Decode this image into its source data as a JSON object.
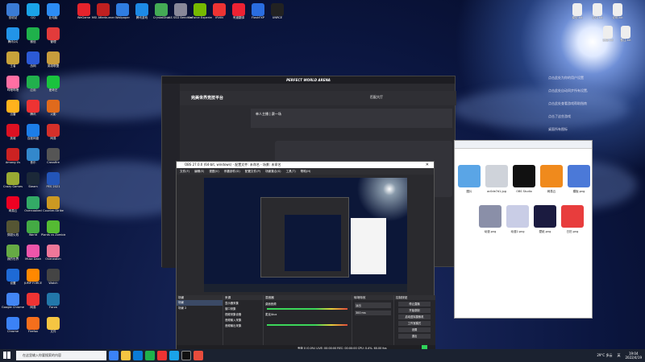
{
  "desktop": {
    "left_icons": [
      {
        "label": "回收站",
        "color": "#3a7bd5"
      },
      {
        "label": "QQ",
        "color": "#1aa3e8"
      },
      {
        "label": "此电脑",
        "color": "#2c8cf4"
      },
      {
        "label": "腾讯QQ",
        "color": "#2294e8"
      },
      {
        "label": "微信",
        "color": "#1fb14b"
      },
      {
        "label": "管理",
        "color": "#e23b3b"
      },
      {
        "label": "王者",
        "color": "#c8a23a"
      },
      {
        "label": "战网",
        "color": "#2c5ad6"
      },
      {
        "label": "英雄联盟",
        "color": "#c89c3c"
      },
      {
        "label": "哔哩哔哩",
        "color": "#ff6fa3"
      },
      {
        "label": "应用",
        "color": "#21b04d"
      },
      {
        "label": "爱奇艺",
        "color": "#19c33e"
      },
      {
        "label": "迅雷",
        "color": "#ffb21c"
      },
      {
        "label": "腾讯",
        "color": "#e33"
      },
      {
        "label": "火影",
        "color": "#e06a1c"
      },
      {
        "label": "英雄",
        "color": "#d12"
      },
      {
        "label": "百度网盘",
        "color": "#1c7de8"
      },
      {
        "label": "网易",
        "color": "#d4302a"
      },
      {
        "label": "Among Us",
        "color": "#c22"
      },
      {
        "label": "音乐",
        "color": "#38c"
      },
      {
        "label": "Crossfire",
        "color": "#555"
      },
      {
        "label": "Crazy Games",
        "color": "#9a3"
      },
      {
        "label": "Steam",
        "color": "#1b2838"
      },
      {
        "label": "PES 2021",
        "color": "#2355b8"
      },
      {
        "label": "网易云",
        "color": "#e02"
      },
      {
        "label": "Overcooked",
        "color": "#3a6"
      },
      {
        "label": "Counter-Strike",
        "color": "#c92"
      },
      {
        "label": "穿越火线",
        "color": "#553"
      },
      {
        "label": "World",
        "color": "#4a4"
      },
      {
        "label": "Plants vs Zombies",
        "color": "#5b3"
      },
      {
        "label": "我的世界",
        "color": "#6a4"
      },
      {
        "label": "Muse Dash",
        "color": "#e5a"
      },
      {
        "label": "Overwatch",
        "color": "#e79"
      },
      {
        "label": "设置",
        "color": "#1e6ad6"
      },
      {
        "label": "JUMP FORCE",
        "color": "#f80"
      },
      {
        "label": "Watch",
        "color": "#444"
      },
      {
        "label": "Google Chrome",
        "color": "#4285f4"
      },
      {
        "label": "网易",
        "color": "#e33"
      },
      {
        "label": "Forza",
        "color": "#27a"
      },
      {
        "label": "Chrome",
        "color": "#3b82f6"
      },
      {
        "label": "Firefox",
        "color": "#f56f1c"
      },
      {
        "label": "文件",
        "color": "#f5c542"
      }
    ],
    "top_icons": [
      {
        "label": "WeGame",
        "color": "#e5232c"
      },
      {
        "label": "MSI Afterburner",
        "color": "#c02020"
      },
      {
        "label": "Wallpaper",
        "color": "#2f7de1"
      },
      {
        "label": "腾讯游戏",
        "color": "#1d8ae6"
      },
      {
        "label": "CrystalDisk",
        "color": "#4a5"
      },
      {
        "label": "AS SSD Benchmark",
        "color": "#889"
      },
      {
        "label": "GeForce Experience",
        "color": "#76b900"
      },
      {
        "label": "IRVIN",
        "color": "#e33"
      },
      {
        "label": "有道翻译",
        "color": "#e23"
      },
      {
        "label": "FlashFXP",
        "color": "#2a6de0"
      },
      {
        "label": "UNRCE",
        "color": "#222"
      }
    ],
    "right_icons": [
      {
        "label": "模型.txt"
      },
      {
        "label": "文件.txt"
      },
      {
        "label": "说明.txt"
      },
      {
        "label": "记录.txt"
      },
      {
        "label": "备注.txt"
      }
    ],
    "notes": [
      "点击此处为你的用户设置",
      "点击此处自动同步所有设置,",
      "点击此处查看游戏帮助指南",
      "点击了这些游戏",
      "桌面所有图标",
      "游戏本",
      "点击此处为你的用户设置"
    ]
  },
  "game_window": {
    "title": "PERFECT WORLD ARENA",
    "logo": "完美世界竞技平台",
    "lobby": "匹配大厅",
    "room": "单人主播 | 赛一场"
  },
  "obs": {
    "title": "OBS 27.0.0 (64-bit, windows) - 配置文件: 未命名 - 场景: 未命名",
    "menu": [
      "文件(F)",
      "编辑(E)",
      "视图(V)",
      "停靠部件(D)",
      "配置文件(P)",
      "场景集合(S)",
      "工具(T)",
      "帮助(H)"
    ],
    "panels": [
      "场景",
      "来源",
      "混音器",
      "转场特效",
      "控制按钮"
    ],
    "scenes": [
      "场景",
      "场景 2"
    ],
    "sources": [
      "显示器采集",
      "窗口采集",
      "视频采集设备",
      "音频输入采集",
      "音频输出采集"
    ],
    "mixer": [
      "桌面音频",
      "麦克/Aux"
    ],
    "transition": {
      "type": "淡出",
      "duration": "300 ms"
    },
    "controls": [
      "停止直播",
      "开始录制",
      "启动虚拟摄像机",
      "工作室模式",
      "设置",
      "退出"
    ],
    "status": "丢帧 0 (0.0%)  LIVE: 00:00:00  REC: 00:00:00  CPU: 0.4%, 60.00 fps"
  },
  "explorer": {
    "files": [
      {
        "label": "图片",
        "color": "#5aa5e6"
      },
      {
        "label": "ac0de7d1.jpg",
        "color": "#cfd3da"
      },
      {
        "label": "OBS Studio",
        "color": "#111"
      },
      {
        "label": "网易云",
        "color": "#f08a1c"
      },
      {
        "label": "模板.png",
        "color": "#4b79d8"
      },
      {
        "label": "动漫.png",
        "color": "#8a8fa8"
      },
      {
        "label": "动漫2.png",
        "color": "#c9cde6"
      },
      {
        "label": "壁纸.png",
        "color": "#1b1b40"
      },
      {
        "label": "日历.png",
        "color": "#e83d3d"
      }
    ]
  },
  "taskbar": {
    "search": "在这里输入你要搜索的内容",
    "weather": "29°C 多云",
    "time": "19:04",
    "date": "2022/4/19",
    "lang": "英"
  },
  "colors": {
    "taskbar": "#1b2230",
    "accent": "#0078d4"
  }
}
